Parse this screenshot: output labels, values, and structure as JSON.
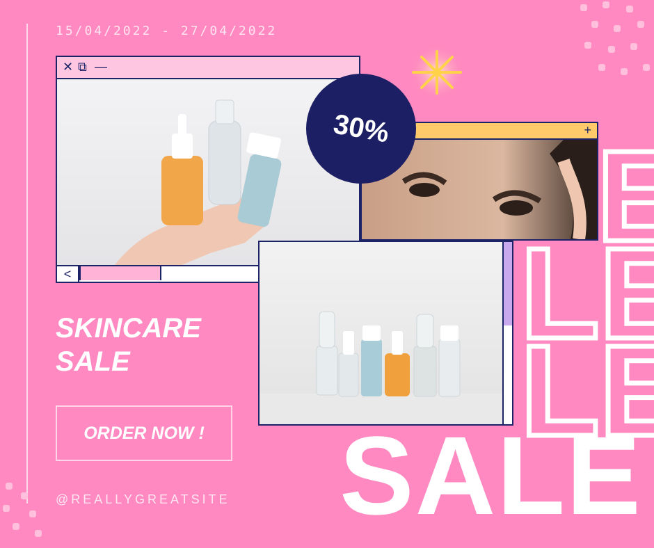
{
  "promo": {
    "date_range": "15/04/2022 - 27/04/2022",
    "discount": "30%",
    "headline_line1": "SKINCARE",
    "headline_line2": "SALE",
    "button_label": "ORDER NOW !",
    "site_handle": "@REALLYGREATSITE",
    "big_word": "SALE",
    "outline_word": "SALE"
  },
  "window1": {
    "title_icons": [
      "close-icon",
      "restore-icon",
      "minimize-icon"
    ],
    "scroll_left": "<",
    "scroll_right": ">",
    "close_glyph": "✕",
    "restore_glyph": "⧉",
    "minimize_glyph": "—"
  },
  "window2": {
    "add_glyph": "+"
  },
  "colors": {
    "background": "#ff89c0",
    "navy": "#1c2366",
    "yellow_bar": "#ffca6a",
    "pink_bar": "#ffc6e2"
  }
}
